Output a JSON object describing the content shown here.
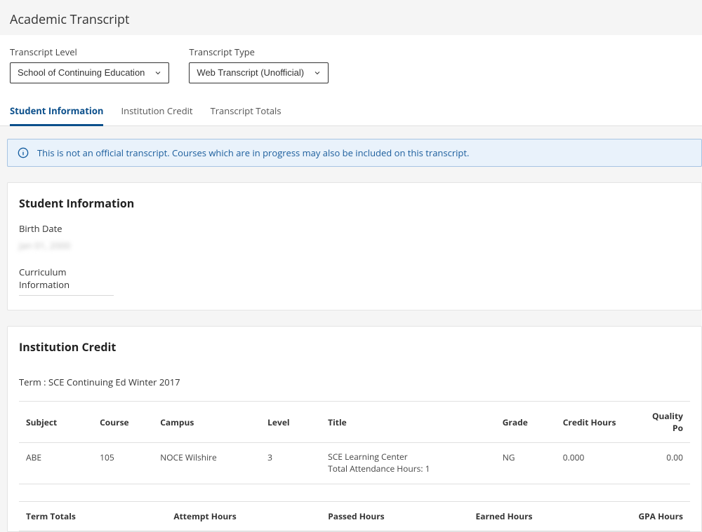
{
  "header": {
    "page_title": "Academic Transcript"
  },
  "filters": {
    "level_label": "Transcript Level",
    "level_value": "School of Continuing Education",
    "type_label": "Transcript Type",
    "type_value": "Web Transcript (Unofficial)"
  },
  "tabs": [
    {
      "label": "Student Information",
      "active": true
    },
    {
      "label": "Institution Credit",
      "active": false
    },
    {
      "label": "Transcript Totals",
      "active": false
    }
  ],
  "banner": {
    "message": "This is not an official transcript. Courses which are in progress may also be included on this transcript."
  },
  "student_info": {
    "card_title": "Student Information",
    "birth_date_label": "Birth Date",
    "birth_date_value": "Jan 01, 2000",
    "curriculum_label": "Curriculum Information"
  },
  "institution_credit": {
    "card_title": "Institution Credit",
    "term_label": "Term : SCE Continuing Ed Winter 2017",
    "columns": {
      "subject": "Subject",
      "course": "Course",
      "campus": "Campus",
      "level": "Level",
      "title": "Title",
      "grade": "Grade",
      "credit_hours": "Credit Hours",
      "quality_points": "Quality Po"
    },
    "rows": [
      {
        "subject": "ABE",
        "course": "105",
        "campus": "NOCE Wilshire",
        "level": "3",
        "title_line1": "SCE Learning Center",
        "title_line2": "Total Attendance Hours: 1",
        "grade": "NG",
        "credit_hours": "0.000",
        "quality_points": "0.00"
      }
    ],
    "totals_columns": {
      "term_totals": "Term Totals",
      "attempt_hours": "Attempt Hours",
      "passed_hours": "Passed Hours",
      "earned_hours": "Earned Hours",
      "gpa_hours": "GPA Hours"
    }
  }
}
